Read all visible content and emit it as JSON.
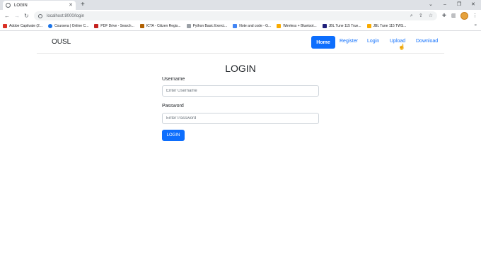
{
  "browser": {
    "tab_title": "LOGIN",
    "url": "localhost:8000/login",
    "bookmarks": [
      {
        "label": "Adobe Captivate (2...",
        "color": "#d93025"
      },
      {
        "label": "Coursera | Online C...",
        "color": "#1a73e8"
      },
      {
        "label": "PDF Drive - Search...",
        "color": "#c5221f"
      },
      {
        "label": "ICTA - Citizen Regis...",
        "color": "#b06000"
      },
      {
        "label": "Python Basic Exerci...",
        "color": "#5f6368"
      },
      {
        "label": "Note and code - G...",
        "color": "#4285f4"
      },
      {
        "label": "Wireless + Bluetoot...",
        "color": "#f9ab00"
      },
      {
        "label": "JBL Tune 115 True...",
        "color": "#1f1f7a"
      },
      {
        "label": "JBL Tune 115 TWS...",
        "color": "#f9ab00"
      }
    ]
  },
  "navbar": {
    "brand": "OUSL",
    "home": "Home",
    "register": "Register",
    "login": "Login",
    "upload": "Upload",
    "download": "Download"
  },
  "form": {
    "title": "LOGIN",
    "username_label": "Username",
    "username_placeholder": "Enter Username",
    "password_label": "Password",
    "password_placeholder": "Enter Password",
    "submit": "LOGIN"
  },
  "colors": {
    "primary": "#0d6efd"
  }
}
